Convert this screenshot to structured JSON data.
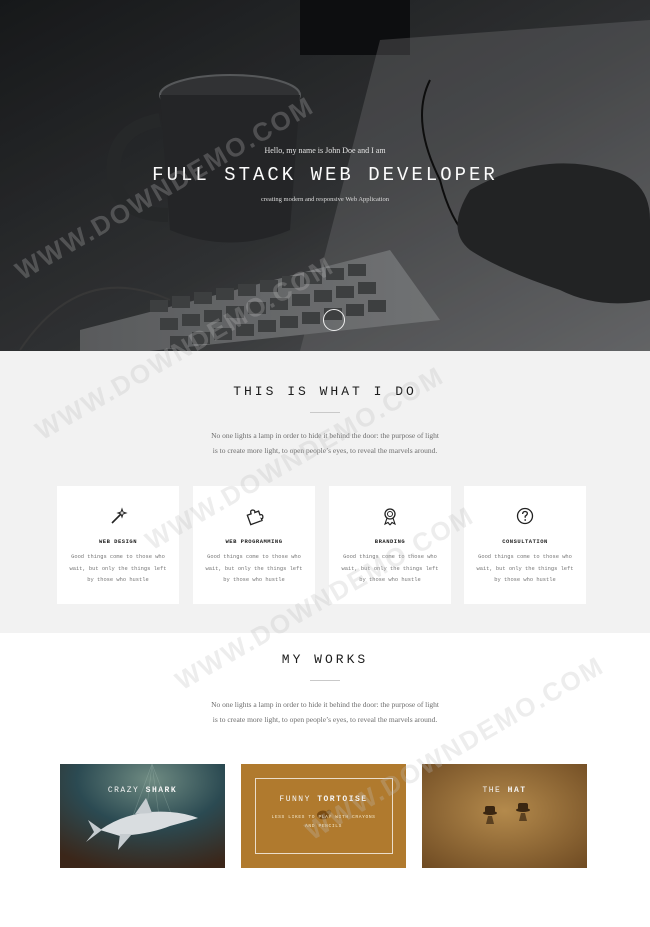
{
  "hero": {
    "intro": "Hello, my name is John Doe and I am",
    "title": "FULL STACK WEB DEVELOPER",
    "subtitle": "creating modern and responsive Web Application"
  },
  "services": {
    "title": "THIS IS WHAT I DO",
    "description_line1": "No one lights a lamp in order to hide it behind the door: the purpose of light",
    "description_line2": "is to create more light, to open people’s eyes, to reveal the marvels around.",
    "items": [
      {
        "icon": "magic-wand-icon",
        "title": "WEB DESIGN",
        "line1": "Good things come to those who",
        "line2": "wait, but only the things left",
        "line3": "by those who hustle"
      },
      {
        "icon": "puzzle-icon",
        "title": "WEB PROGRAMMING",
        "line1": "Good things come to those who",
        "line2": "wait, but only the things left",
        "line3": "by those who hustle"
      },
      {
        "icon": "award-ribbon-icon",
        "title": "BRANDING",
        "line1": "Good things come to those who",
        "line2": "wait, but only the things left",
        "line3": "by those who hustle"
      },
      {
        "icon": "question-circle-icon",
        "title": "CONSULTATION",
        "line1": "Good things come to those who",
        "line2": "wait, but only the things left",
        "line3": "by those who hustle"
      }
    ]
  },
  "works": {
    "title": "MY WORKS",
    "description_line1": "No one lights a lamp in order to hide it behind the door: the purpose of light",
    "description_line2": "is to create more light, to open people’s eyes, to reveal the marvels around.",
    "items": [
      {
        "title_a": "CRAZY ",
        "title_b": "SHARK"
      },
      {
        "title_a": "FUNNY ",
        "title_b": "TORTOISE",
        "sub1": "LESS LIKES TO PLAY WITH CRAYONS",
        "sub2": "AND PENCILS"
      },
      {
        "title_a": "THE ",
        "title_b": "HAT"
      }
    ]
  },
  "watermark": "WWW.DOWNDEMO.COM",
  "colors": {
    "hero_bg": "#2a2c2e",
    "services_bg": "#f2f2f2",
    "shark_bg": "#1f3a44",
    "tortoise_bg": "#b07a2e",
    "hat_bg": "#8a6532"
  }
}
